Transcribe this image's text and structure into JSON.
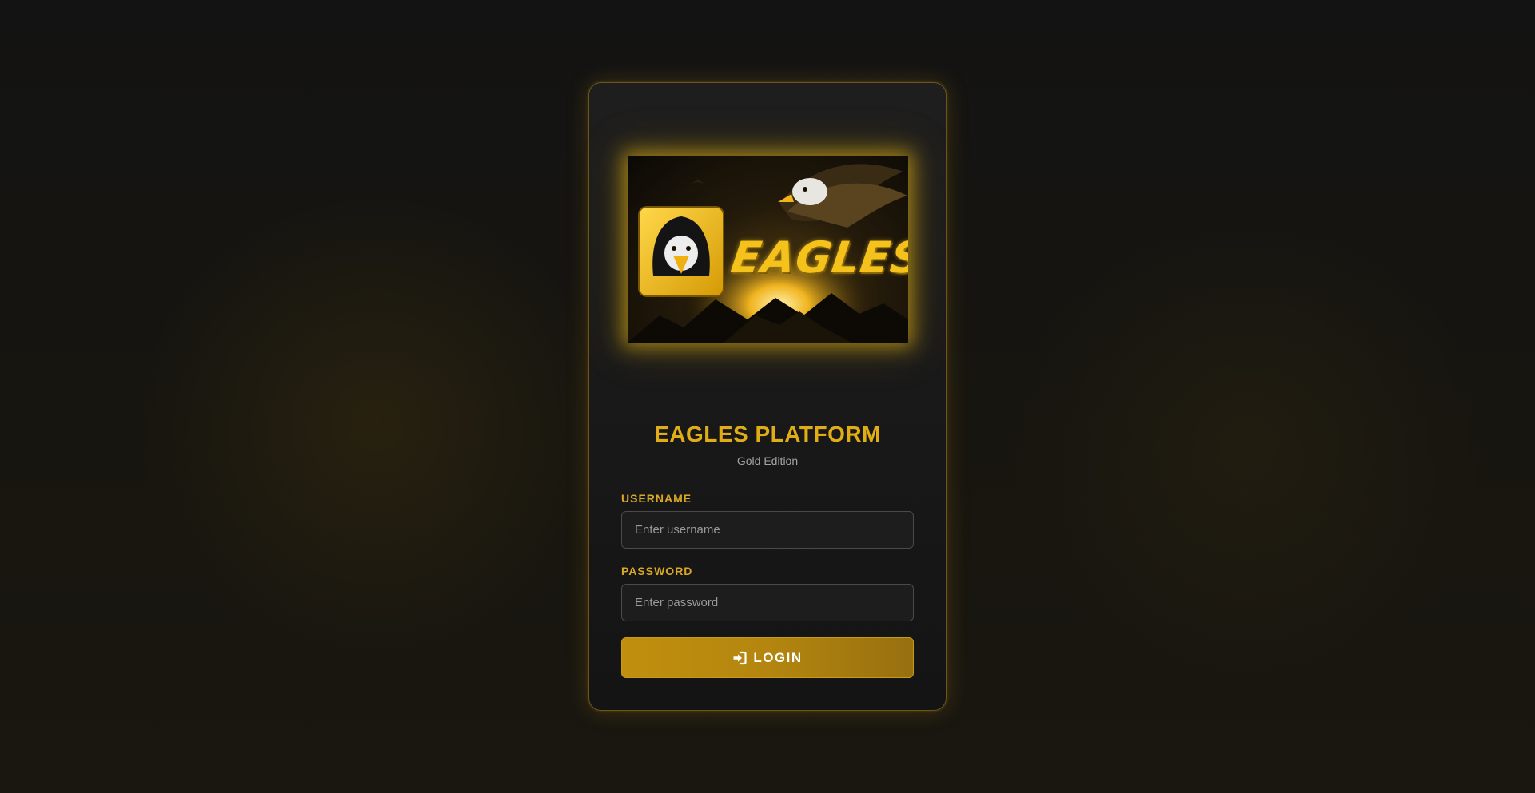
{
  "brand": {
    "logo_word": "EAGLES",
    "title": "EAGLES PLATFORM",
    "subtitle": "Gold Edition"
  },
  "form": {
    "username_label": "USERNAME",
    "username_placeholder": "Enter username",
    "password_label": "PASSWORD",
    "password_placeholder": "Enter password",
    "login_label": "LOGIN",
    "login_icon": "sign-in-icon"
  },
  "colors": {
    "accent": "#e0ad16",
    "button": "#b4860f",
    "background": "#141414"
  }
}
